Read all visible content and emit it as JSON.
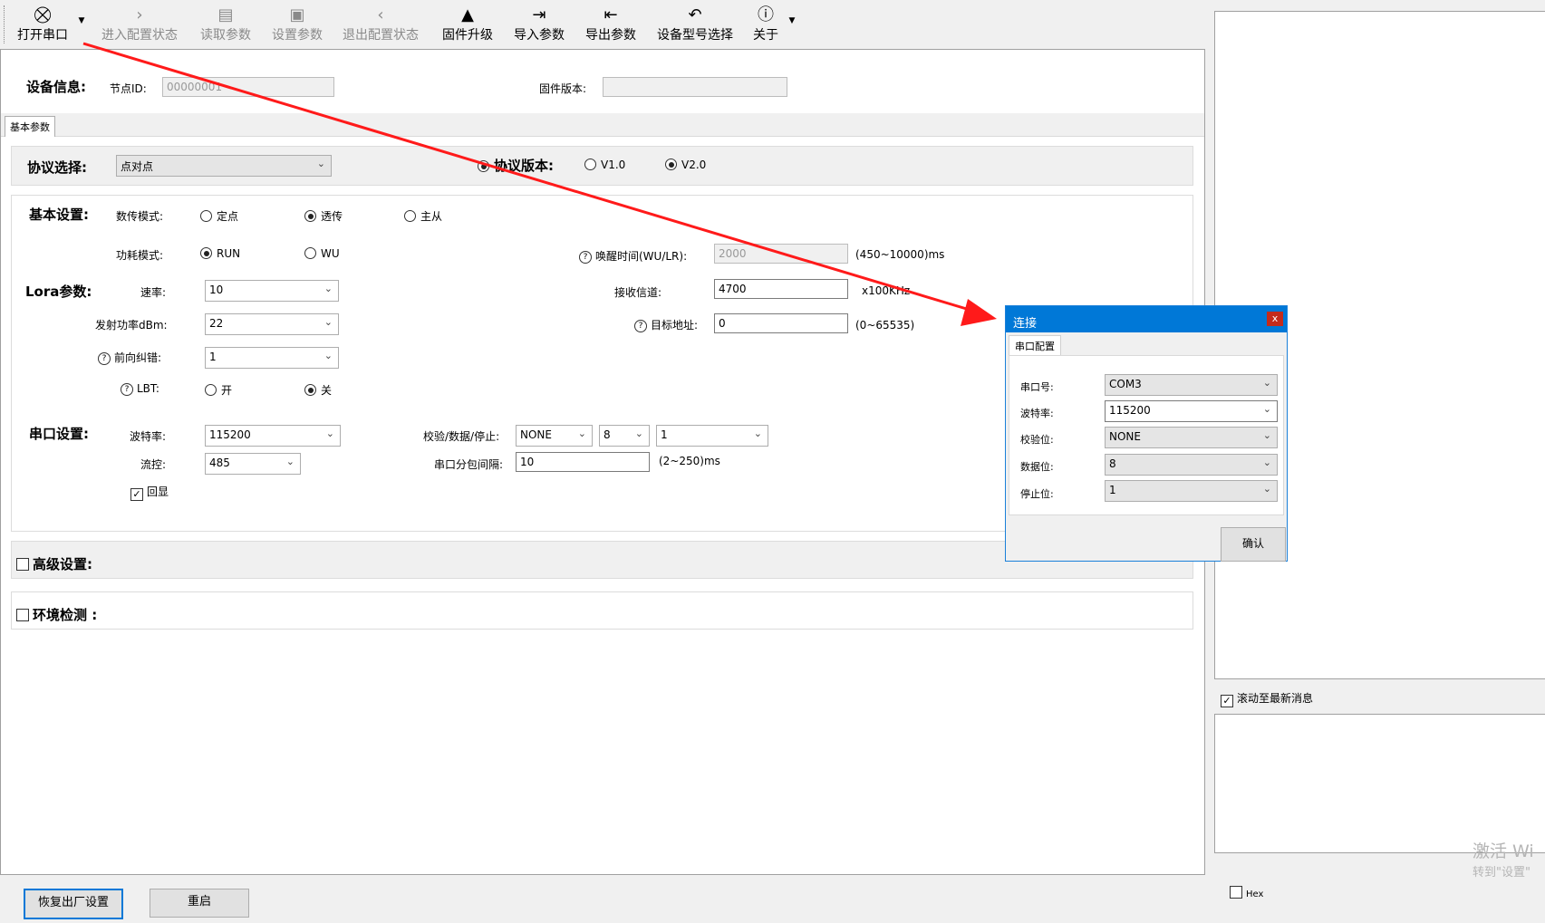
{
  "toolbar": {
    "open_port": "打开串口",
    "enter_config": "进入配置状态",
    "read_params": "读取参数",
    "set_params": "设置参数",
    "exit_config": "退出配置状态",
    "firmware_upgrade": "固件升级",
    "import_params": "导入参数",
    "export_params": "导出参数",
    "device_model": "设备型号选择",
    "about": "关于"
  },
  "device_info": {
    "heading": "设备信息:",
    "node_id_label": "节点ID:",
    "node_id_value": "00000001",
    "fw_label": "固件版本:",
    "fw_value": ""
  },
  "tab": {
    "basic": "基本参数"
  },
  "protocol": {
    "heading": "协议选择:",
    "selected": "点对点",
    "version_heading": "协议版本:",
    "v1": "V1.0",
    "v2": "V2.0"
  },
  "basic": {
    "heading": "基本设置:",
    "transfer_mode_label": "数传模式:",
    "mode_fixed": "定点",
    "mode_transparent": "透传",
    "mode_master": "主从",
    "power_mode_label": "功耗模式:",
    "power_run": "RUN",
    "power_wu": "WU",
    "wake_label": "唤醒时间(WU/LR):",
    "wake_value": "2000",
    "wake_range": "(450~10000)ms"
  },
  "lora": {
    "heading": "Lora参数:",
    "rate_label": "速率:",
    "rate_value": "10",
    "tx_power_label": "发射功率dBm:",
    "tx_power_value": "22",
    "fec_label": "前向纠错:",
    "fec_value": "1",
    "lbt_label": "LBT:",
    "lbt_on": "开",
    "lbt_off": "关",
    "rx_channel_label": "接收信道:",
    "rx_channel_value": "4700",
    "rx_channel_unit": "x100KHz",
    "target_label": "目标地址:",
    "target_value": "0",
    "target_range": "(0~65535)"
  },
  "serial": {
    "heading": "串口设置:",
    "baud_label": "波特率:",
    "baud_value": "115200",
    "flow_label": "流控:",
    "flow_value": "485",
    "echo_label": "回显",
    "parity_label": "校验/数据/停止:",
    "parity_value": "NONE",
    "data_value": "8",
    "stop_value": "1",
    "packet_label": "串口分包间隔:",
    "packet_value": "10",
    "packet_range": "(2~250)ms"
  },
  "advanced": {
    "label": "高级设置:"
  },
  "env": {
    "label": "环境检测 :"
  },
  "bottom": {
    "factory_reset": "恢复出厂设置",
    "restart": "重启"
  },
  "right": {
    "scroll_latest": "滚动至最新消息",
    "hex": "Hex",
    "watermark1": "激活 Wi",
    "watermark2": "转到\"设置\""
  },
  "dialog": {
    "title": "连接",
    "close": "x",
    "tab": "串口配置",
    "port_label": "串口号:",
    "port_value": "COM3",
    "baud_label": "波特率:",
    "baud_value": "115200",
    "parity_label": "校验位:",
    "parity_value": "NONE",
    "data_label": "数据位:",
    "data_value": "8",
    "stop_label": "停止位:",
    "stop_value": "1",
    "confirm": "确认"
  },
  "colors": {
    "accent": "#0078d7",
    "arrow": "#ff1a1a",
    "close": "#c42b1c"
  }
}
